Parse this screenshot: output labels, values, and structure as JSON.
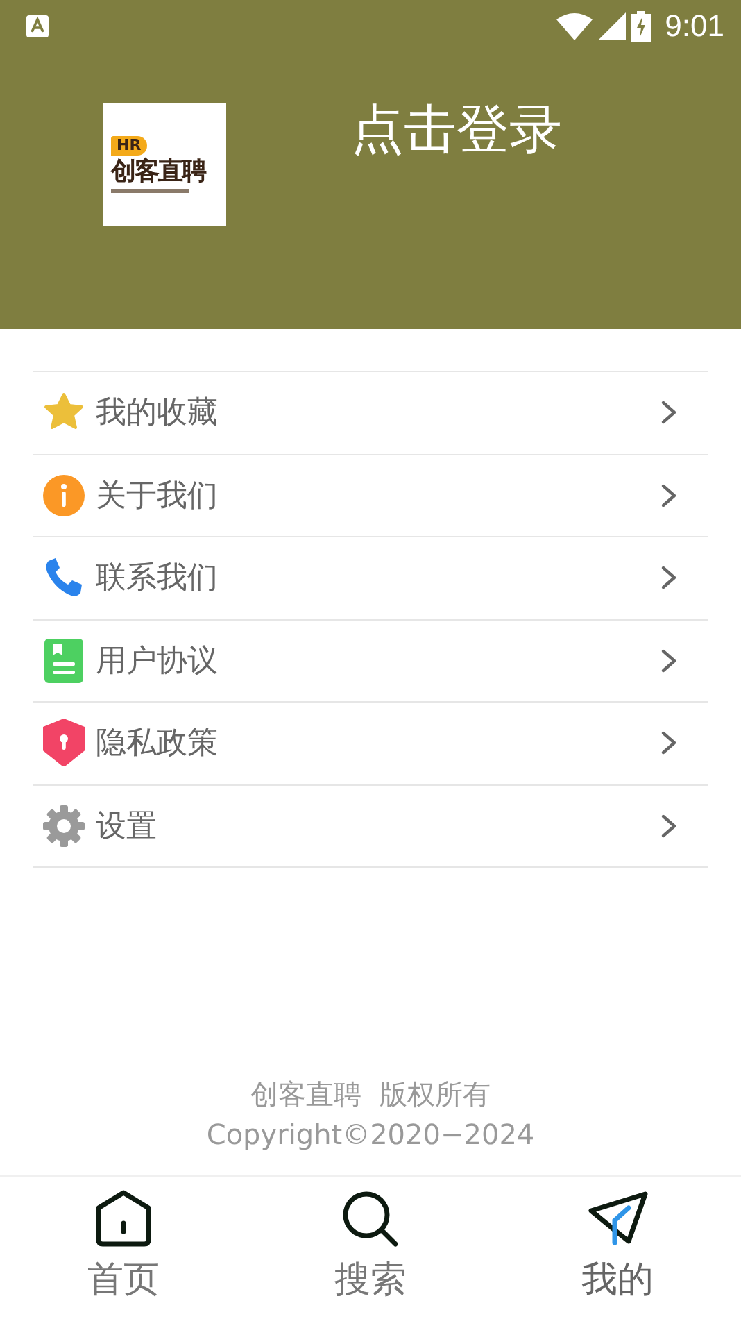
{
  "status_bar": {
    "time": "9:01"
  },
  "header": {
    "logo": {
      "badge": "HR",
      "name": "创客直聘"
    },
    "login": "点击登录"
  },
  "menu": [
    {
      "kind": "star",
      "label": "我的收藏"
    },
    {
      "kind": "info",
      "label": "关于我们"
    },
    {
      "kind": "phone",
      "label": "联系我们"
    },
    {
      "kind": "document",
      "label": "用户协议"
    },
    {
      "kind": "shield",
      "label": "隐私政策"
    },
    {
      "kind": "gear",
      "label": "设置"
    }
  ],
  "footer": {
    "line_1": "创客直聘  版权所有",
    "line_2": "Copyright©2020−2024"
  },
  "tab_bar": [
    {
      "kind": "home",
      "label": "首页",
      "selected": false
    },
    {
      "kind": "search",
      "label": "搜索",
      "selected": false
    },
    {
      "kind": "send",
      "label": "我的",
      "selected": true
    }
  ]
}
